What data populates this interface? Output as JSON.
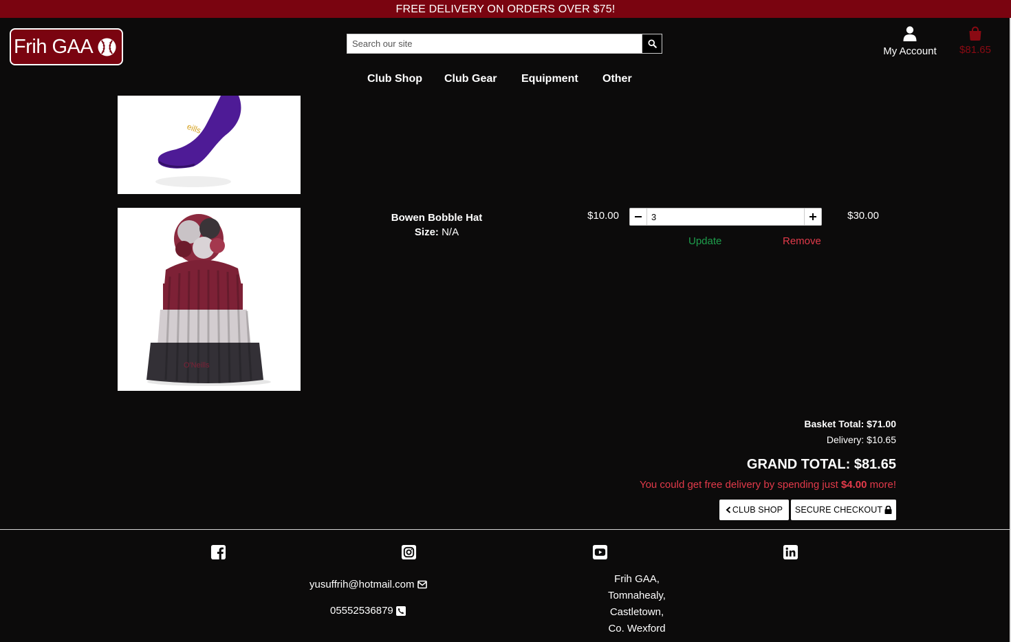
{
  "banner": {
    "text": "FREE DELIVERY ON ORDERS OVER $75!"
  },
  "header": {
    "logo_text": "Frih GAA",
    "search_placeholder": "Search our site",
    "account_label": "My Account",
    "bag_total": "$81.65"
  },
  "nav": {
    "items": [
      "Club Shop",
      "Club Gear",
      "Equipment",
      "Other"
    ]
  },
  "basket": {
    "items": [
      {
        "name": "Bowen Bobble Hat",
        "size_label": "Size:",
        "size_value": "N/A",
        "price": "$10.00",
        "quantity": "3",
        "subtotal": "$30.00",
        "update_label": "Update",
        "remove_label": "Remove"
      }
    ]
  },
  "summary": {
    "basket_total": "Basket Total: $71.00",
    "delivery": "Delivery: $10.65",
    "grand_total": "GRAND TOTAL: $81.65",
    "free_delivery_prefix": "You could get free delivery by spending just",
    "free_delivery_amount": "$4.00",
    "free_delivery_suffix": "more!",
    "club_shop_button": "CLUB SHOP",
    "checkout_button": "SECURE CHECKOUT"
  },
  "footer": {
    "email": "yusuffrih@hotmail.com",
    "phone": "05552536879",
    "address": [
      "Frih GAA,",
      "Tomnahealy,",
      "Castletown,",
      "Co. Wexford"
    ],
    "social": [
      "facebook-icon",
      "instagram-icon",
      "youtube-icon",
      "linkedin-icon"
    ]
  },
  "colors": {
    "brand": "#7a0410",
    "update": "#1e9e4c",
    "remove": "#e23a4a"
  }
}
